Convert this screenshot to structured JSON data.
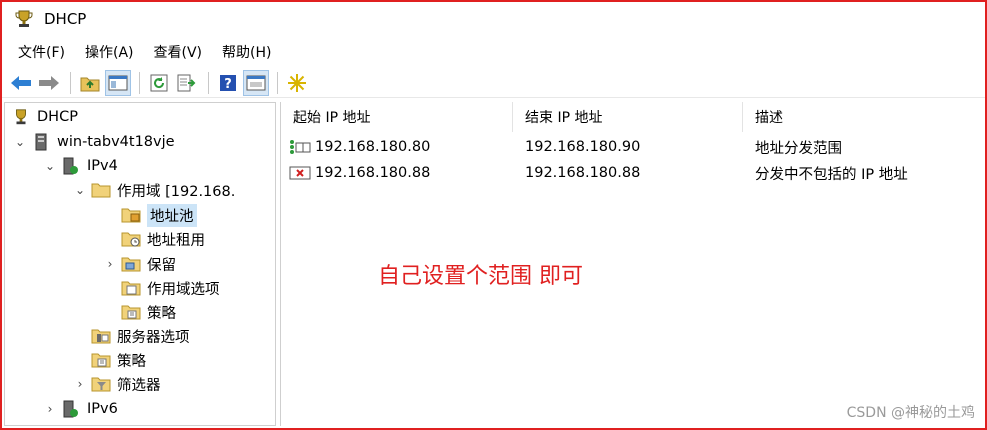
{
  "window": {
    "title": "DHCP"
  },
  "menu": [
    "文件(F)",
    "操作(A)",
    "查看(V)",
    "帮助(H)"
  ],
  "toolbar": {
    "buttons": [
      "back-icon",
      "forward-icon",
      "up-folder-icon",
      "show-hide-tree-icon",
      "refresh-icon",
      "export-list-icon",
      "help-icon",
      "properties-icon",
      "new-item-star-icon"
    ],
    "pressed": [
      "show-hide-tree-icon",
      "properties-icon"
    ]
  },
  "tree": {
    "items": [
      {
        "label": "DHCP",
        "level": 0,
        "arrow": "",
        "icon": "dhcp-trophy-icon"
      },
      {
        "label": "win-tabv4t18vje",
        "level": 1,
        "arrow": "⌄",
        "icon": "server-icon"
      },
      {
        "label": "IPv4",
        "level": 2,
        "arrow": "⌄",
        "icon": "ipv4-icon"
      },
      {
        "label": "作用域 [192.168.",
        "level": 3,
        "arrow": "⌄",
        "icon": "folder-icon"
      },
      {
        "label": "地址池",
        "level": 4,
        "arrow": "",
        "icon": "address-pool-icon",
        "selected": true
      },
      {
        "label": "地址租用",
        "level": 4,
        "arrow": "",
        "icon": "lease-icon"
      },
      {
        "label": "保留",
        "level": 4,
        "arrow": "›",
        "icon": "reservation-icon"
      },
      {
        "label": "作用域选项",
        "level": 4,
        "arrow": "",
        "icon": "scope-options-icon"
      },
      {
        "label": "策略",
        "level": 4,
        "arrow": "",
        "icon": "policy-icon"
      },
      {
        "label": "服务器选项",
        "level": 3,
        "arrow": "",
        "icon": "server-options-icon"
      },
      {
        "label": "策略",
        "level": 3,
        "arrow": "",
        "icon": "policy-icon"
      },
      {
        "label": "筛选器",
        "level": 3,
        "arrow": "›",
        "icon": "filter-icon"
      },
      {
        "label": "IPv6",
        "level": 2,
        "arrow": "›",
        "icon": "ipv6-icon"
      }
    ]
  },
  "list": {
    "columns": [
      "起始 IP 地址",
      "结束 IP 地址",
      "描述"
    ],
    "rows": [
      {
        "start": "192.168.180.80",
        "end": "192.168.180.90",
        "desc": "地址分发范围",
        "icon": "range-icon"
      },
      {
        "start": "192.168.180.88",
        "end": "192.168.180.88",
        "desc": "分发中不包括的 IP 地址",
        "icon": "exclusion-icon"
      }
    ]
  },
  "annotation": "自己设置个范围 即可",
  "watermark": "CSDN @神秘的土鸡",
  "colors": {
    "annotation": "#e02020",
    "frame": "#e02020",
    "selection": "#cce4f7"
  }
}
